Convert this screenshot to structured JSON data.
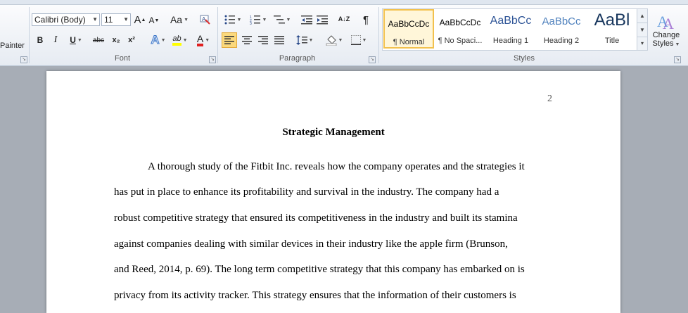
{
  "ribbon": {
    "clipboard": {
      "painter_label": "Painter"
    },
    "font": {
      "group_label": "Font",
      "font_name": "Calibri (Body)",
      "font_size": "11",
      "grow_label": "A",
      "shrink_label": "A",
      "change_case_label": "Aa",
      "bold_label": "B",
      "italic_label": "I",
      "underline_label": "U",
      "strike_label": "abc",
      "subscript_label": "x₂",
      "superscript_label": "x²",
      "text_effects_label": "A",
      "highlight_label": "ab",
      "font_color_label": "A",
      "highlight_color": "#ffff00",
      "font_color": "#e02020"
    },
    "paragraph": {
      "group_label": "Paragraph",
      "sort_label": "A↓Z",
      "pilcrow_label": "¶"
    },
    "styles": {
      "group_label": "Styles",
      "items": [
        {
          "sample": "AaBbCcDc",
          "name": "¶ Normal"
        },
        {
          "sample": "AaBbCcDc",
          "name": "¶ No Spaci..."
        },
        {
          "sample": "AaBbCc",
          "name": "Heading 1"
        },
        {
          "sample": "AaBbCc",
          "name": "Heading 2"
        },
        {
          "sample": "AaBl",
          "name": "Title"
        }
      ],
      "change_styles_line1": "Change",
      "change_styles_line2": "Styles"
    }
  },
  "document": {
    "page_number": "2",
    "title": "Strategic Management",
    "lines": [
      "A thorough study of the Fitbit Inc. reveals how the company operates and the strategies it",
      "has put in place to enhance its profitability and survival in the industry. The company had a",
      "robust competitive strategy that ensured its competitiveness in the industry and built its stamina",
      "against companies  dealing with similar  devices in their industry like the apple firm (Brunson,",
      "and Reed, 2014, p. 69). The long term competitive strategy that this company has embarked on is",
      "privacy from its activity tracker. This strategy ensures that the information of their customers is"
    ]
  },
  "colors": {
    "heading_blue": "#2f5597",
    "selected_style_border": "#f2c14e"
  }
}
